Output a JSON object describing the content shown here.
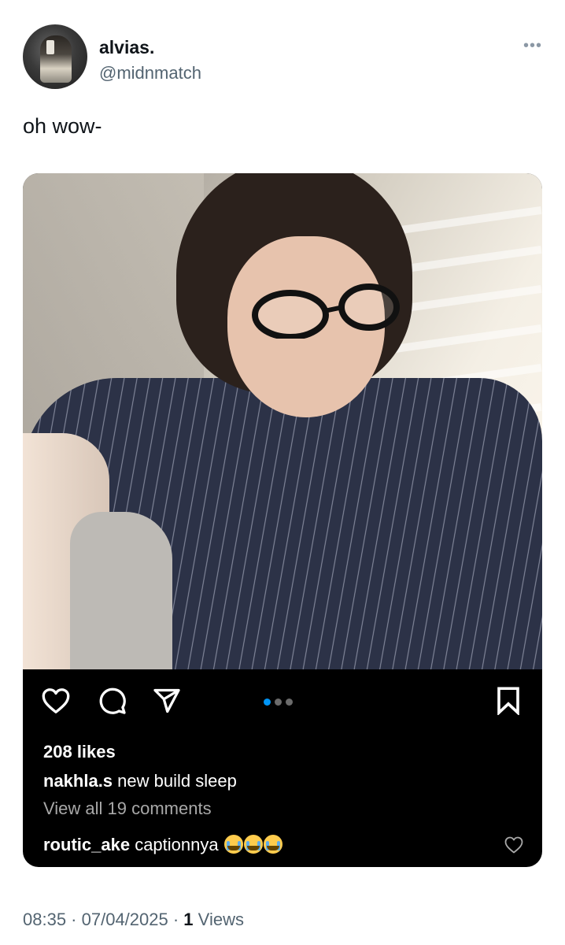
{
  "tweet": {
    "author_name": "alvias.",
    "author_handle": "@midnmatch",
    "text": "oh wow-",
    "more_icon": "ellipsis-icon"
  },
  "instagram_post": {
    "likes": "208 likes",
    "caption_user": "nakhla.s",
    "caption_text": "new build sleep",
    "view_comments": "View all 19 comments",
    "comment_user": "routic_ake",
    "comment_text": "captionnya",
    "comment_emoji": "loudly-crying-face x3",
    "carousel": {
      "total": 3,
      "active_index": 0
    },
    "colors": {
      "accent": "#0095f6",
      "background": "#000000",
      "text": "#ffffff",
      "muted": "#a8a8a8"
    }
  },
  "footer": {
    "time": "08:35",
    "separator": " · ",
    "date": "07/04/2025",
    "views_count": "1",
    "views_label": "Views"
  }
}
